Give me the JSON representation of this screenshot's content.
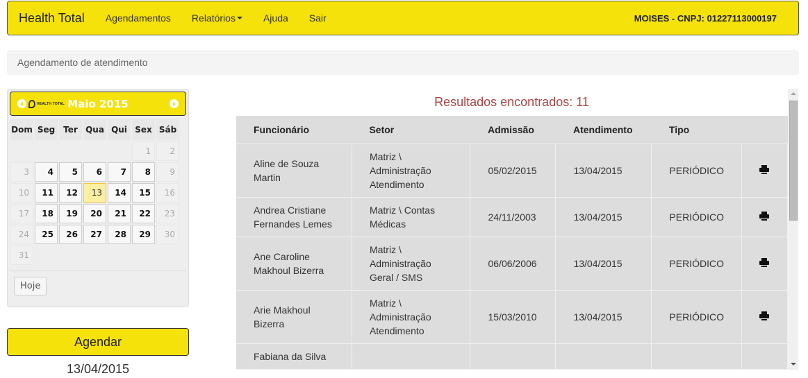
{
  "navbar": {
    "brand": "Health Total",
    "links": [
      {
        "label": "Agendamentos"
      },
      {
        "label": "Relatórios",
        "dropdown": true
      },
      {
        "label": "Ajuda"
      },
      {
        "label": "Sair"
      }
    ],
    "user_info": "MOISES - CNPJ: 01227113000197"
  },
  "breadcrumb": "Agendamento de atendimento",
  "calendar": {
    "month_title": "Maio 2015",
    "logo_text": "HEALTH TOTAL",
    "prev_icon": "circle-left-arrow-icon",
    "next_icon": "circle-right-arrow-icon",
    "weekdays": [
      "Dom",
      "Seg",
      "Ter",
      "Qua",
      "Qui",
      "Sex",
      "Sáb"
    ],
    "weeks": [
      [
        null,
        null,
        null,
        null,
        null,
        {
          "d": "1",
          "t": "other"
        },
        {
          "d": "2",
          "t": "other"
        }
      ],
      [
        {
          "d": "3",
          "t": "other"
        },
        {
          "d": "4"
        },
        {
          "d": "5"
        },
        {
          "d": "6"
        },
        {
          "d": "7"
        },
        {
          "d": "8"
        },
        {
          "d": "9",
          "t": "other"
        }
      ],
      [
        {
          "d": "10",
          "t": "other"
        },
        {
          "d": "11"
        },
        {
          "d": "12"
        },
        {
          "d": "13",
          "t": "today"
        },
        {
          "d": "14"
        },
        {
          "d": "15"
        },
        {
          "d": "16",
          "t": "other"
        }
      ],
      [
        {
          "d": "17",
          "t": "other"
        },
        {
          "d": "18"
        },
        {
          "d": "19"
        },
        {
          "d": "20"
        },
        {
          "d": "21"
        },
        {
          "d": "22"
        },
        {
          "d": "23",
          "t": "other"
        }
      ],
      [
        {
          "d": "24",
          "t": "other"
        },
        {
          "d": "25"
        },
        {
          "d": "26"
        },
        {
          "d": "27"
        },
        {
          "d": "28"
        },
        {
          "d": "29"
        },
        {
          "d": "30",
          "t": "other"
        }
      ],
      [
        {
          "d": "31",
          "t": "other"
        },
        null,
        null,
        null,
        null,
        null,
        null
      ]
    ],
    "today_button": "Hoje"
  },
  "actions": {
    "schedule_button": "Agendar",
    "selected_date": "13/04/2015"
  },
  "results": {
    "title": "Resultados encontrados: 11",
    "columns": [
      "Funcionário",
      "Setor",
      "Admissão",
      "Atendimento",
      "Tipo",
      ""
    ],
    "rows": [
      {
        "funcionario": "Aline de Souza Martin",
        "setor": "Matriz \\ Administração Atendimento",
        "admissao": "05/02/2015",
        "atendimento": "13/04/2015",
        "tipo": "PERIÓDICO",
        "action_icon": "printer-icon"
      },
      {
        "funcionario": "Andrea Cristiane Fernandes Lemes",
        "setor": "Matriz \\ Contas Médicas",
        "admissao": "24/11/2003",
        "atendimento": "13/04/2015",
        "tipo": "PERIÓDICO",
        "action_icon": "printer-icon"
      },
      {
        "funcionario": "Ane Caroline Makhoul Bizerra",
        "setor": "Matriz \\ Administração Geral / SMS",
        "admissao": "06/06/2006",
        "atendimento": "13/04/2015",
        "tipo": "PERIÓDICO",
        "action_icon": "printer-icon"
      },
      {
        "funcionario": "Arie Makhoul Bizerra",
        "setor": "Matriz \\ Administração Atendimento",
        "admissao": "15/03/2010",
        "atendimento": "13/04/2015",
        "tipo": "PERIÓDICO",
        "action_icon": "printer-icon"
      },
      {
        "funcionario": "Fabiana da Silva",
        "setor": "",
        "admissao": "",
        "atendimento": "",
        "tipo": "",
        "action_icon": ""
      }
    ]
  },
  "colors": {
    "brand_yellow": "#f5e20a",
    "results_title": "#a94442",
    "table_bg": "#dddddd",
    "today_highlight": "#fcefa1"
  }
}
